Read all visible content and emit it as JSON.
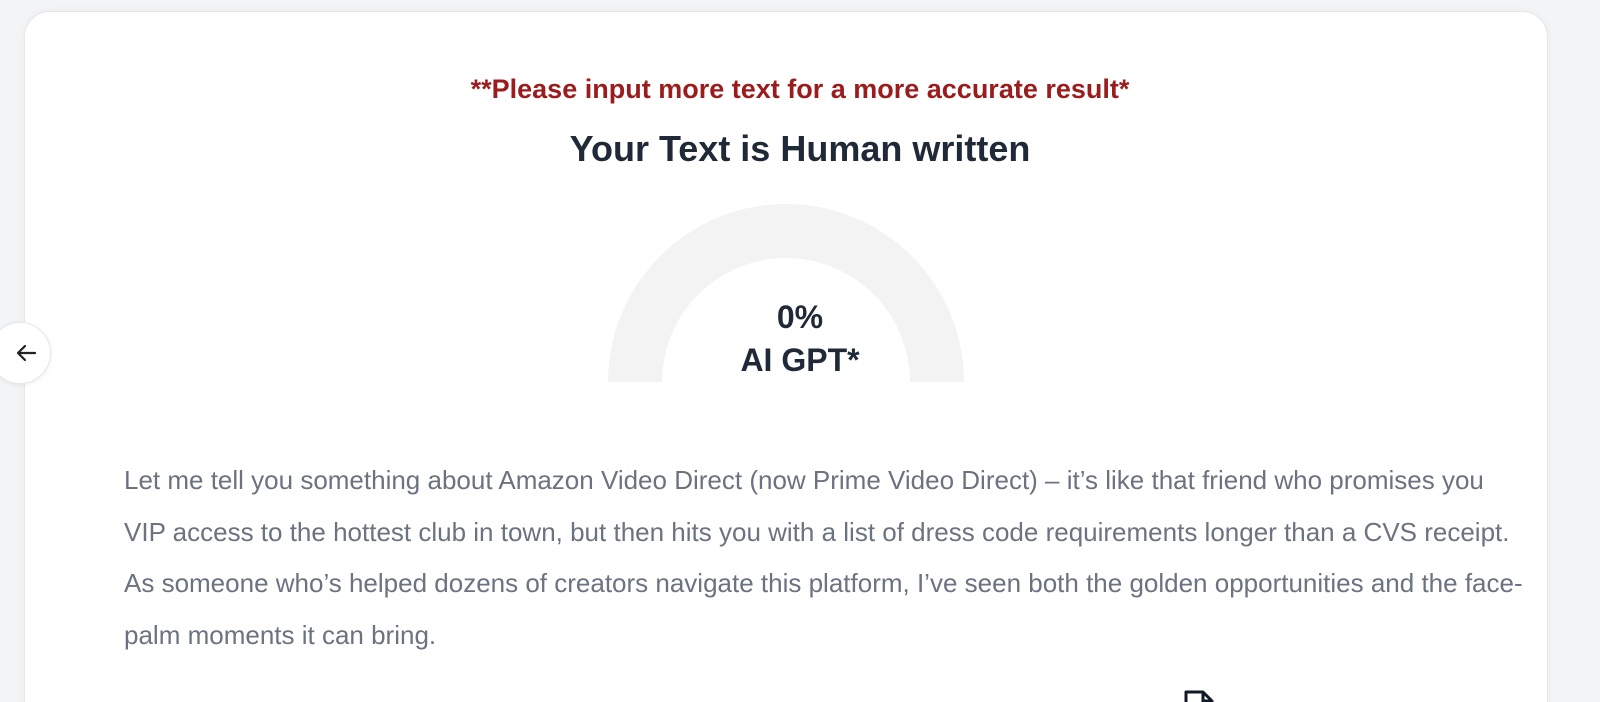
{
  "result": {
    "warning": "**Please input more text for a more accurate result*",
    "heading": "Your Text is Human written"
  },
  "gauge": {
    "percent_text": "0%",
    "label": "AI GPT*",
    "value_fraction": 0,
    "track_color": "#f3f3f3",
    "fill_color": "#e53e3e"
  },
  "navigation": {
    "back_icon": "arrow-left-icon"
  },
  "content": {
    "paragraph": "Let me tell you something about Amazon Video Direct (now Prime Video Direct) – it’s like that friend who promises you VIP access to the hottest club in town, but then hits you with a list of dress code requirements longer than a CVS receipt. As someone who’s helped dozens of creators navigate this platform, I’ve seen both the golden opportunities and the face-palm moments it can bring."
  },
  "actions": {
    "export_icon": "document-icon"
  },
  "colors": {
    "warning": "#9b1c1c",
    "heading": "#1f2937",
    "body_text": "#6b7280",
    "card_background": "#ffffff",
    "page_background": "#f3f4f6"
  }
}
